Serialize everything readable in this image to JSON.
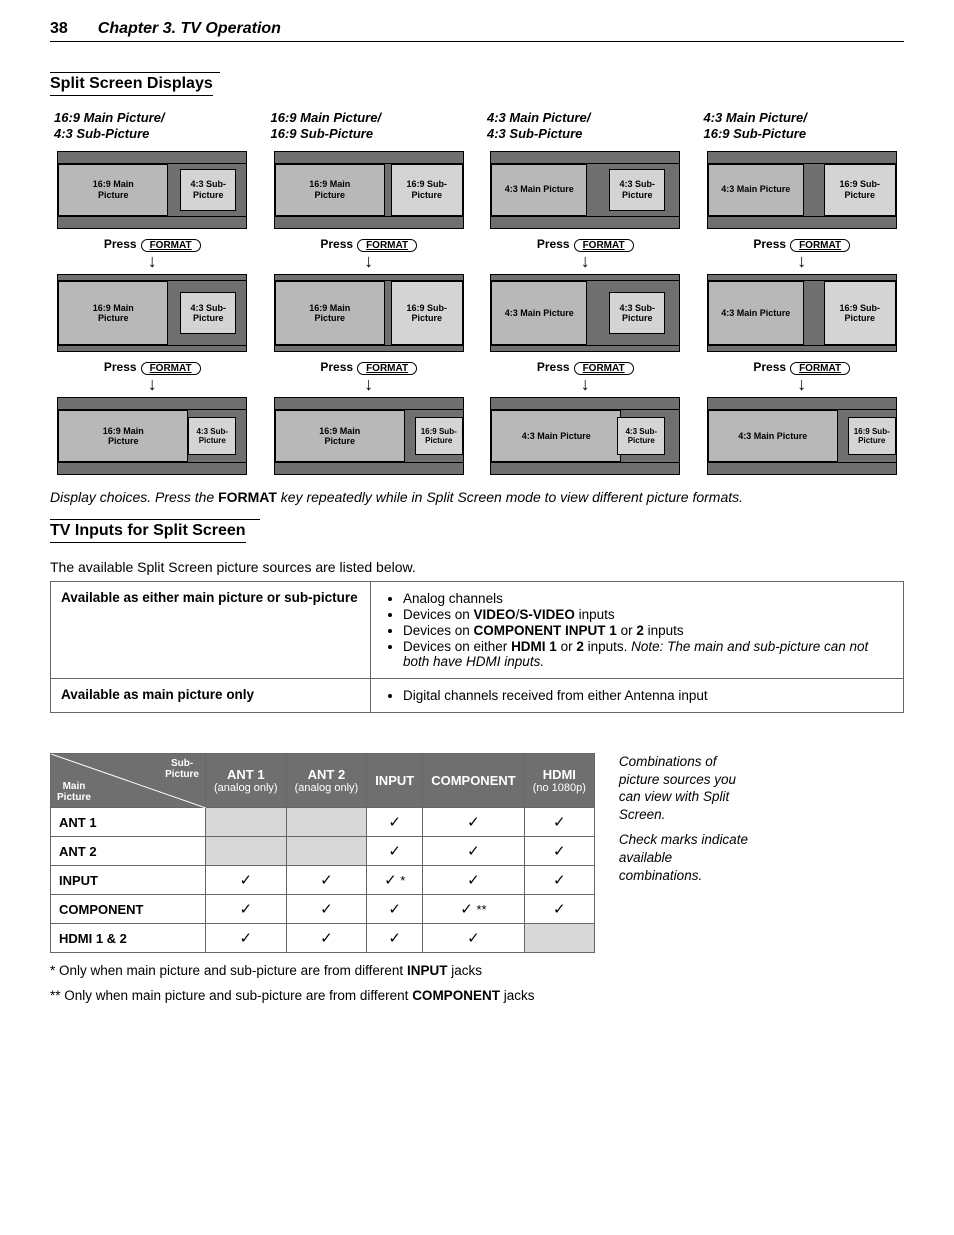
{
  "header": {
    "page": "38",
    "chapter": "Chapter 3. TV Operation"
  },
  "sec1": {
    "title": "Split Screen Displays",
    "columns": [
      {
        "title": "16:9 Main Picture/\n4:3 Sub-Picture",
        "main": "16:9 Main\nPicture",
        "sub": "4:3 Sub-\nPicture"
      },
      {
        "title": "16:9 Main Picture/\n16:9 Sub-Picture",
        "main": "16:9 Main\nPicture",
        "sub": "16:9 Sub-\nPicture"
      },
      {
        "title": "4:3 Main Picture/\n4:3 Sub-Picture",
        "main": "4:3 Main Picture",
        "sub": "4:3 Sub-\nPicture"
      },
      {
        "title": "4:3 Main Picture/\n16:9 Sub-Picture",
        "main": "4:3 Main Picture",
        "sub": "16:9 Sub-\nPicture"
      }
    ],
    "press": "Press",
    "key": "FORMAT",
    "caption_pre": "Display choices.  Press the ",
    "caption_key": "FORMAT",
    "caption_post": " key repeatedly while in Split Screen mode to view different picture formats."
  },
  "sec2": {
    "title": "TV Inputs for Split Screen",
    "intro": "The available Split Screen picture sources are listed below.",
    "rowA": {
      "label": "Available as either main picture or sub-picture",
      "i1": "Analog channels",
      "i2a": "Devices on ",
      "i2b": "VIDEO",
      "i2c": "/",
      "i2d": "S-VIDEO",
      "i2e": " inputs",
      "i3a": "Devices on ",
      "i3b": "COMPONENT INPUT 1",
      "i3c": " or ",
      "i3d": "2",
      "i3e": " inputs",
      "i4a": "Devices on either ",
      "i4b": "HDMI 1",
      "i4c": " or ",
      "i4d": "2",
      "i4e": " inputs. ",
      "i4note": "Note: The main and sub-picture can not both have HDMI inputs."
    },
    "rowB": {
      "label": "Available as main picture only",
      "i1": "Digital channels received from either Antenna input"
    }
  },
  "matrix": {
    "corner_a": "Sub-\nPicture",
    "corner_b": "Main\nPicture",
    "cols": [
      {
        "h": "ANT 1",
        "s": "(analog only)"
      },
      {
        "h": "ANT 2",
        "s": "(analog only)"
      },
      {
        "h": "INPUT",
        "s": ""
      },
      {
        "h": "COMPONENT",
        "s": ""
      },
      {
        "h": "HDMI",
        "s": "(no 1080p)"
      }
    ],
    "rows": [
      {
        "h": "ANT 1",
        "c": [
          "grey",
          "grey",
          "chk",
          "chk",
          "chk"
        ]
      },
      {
        "h": "ANT 2",
        "c": [
          "grey",
          "grey",
          "chk",
          "chk",
          "chk"
        ]
      },
      {
        "h": "INPUT",
        "c": [
          "chk",
          "chk",
          "chk*",
          "chk",
          "chk"
        ]
      },
      {
        "h": "COMPONENT",
        "c": [
          "chk",
          "chk",
          "chk",
          "chk**",
          "chk"
        ]
      },
      {
        "h": "HDMI 1 & 2",
        "c": [
          "chk",
          "chk",
          "chk",
          "chk",
          "grey"
        ]
      }
    ],
    "side1": "Combinations of picture sources you can view with Split Screen.",
    "side2": "Check marks indicate available combinations.",
    "foot1a": "*  Only when main picture and sub-picture are from different ",
    "foot1b": "INPUT",
    "foot1c": " jacks",
    "foot2a": "** Only when main picture and sub-picture are from different ",
    "foot2b": "COMPONENT",
    "foot2c": " jacks"
  }
}
